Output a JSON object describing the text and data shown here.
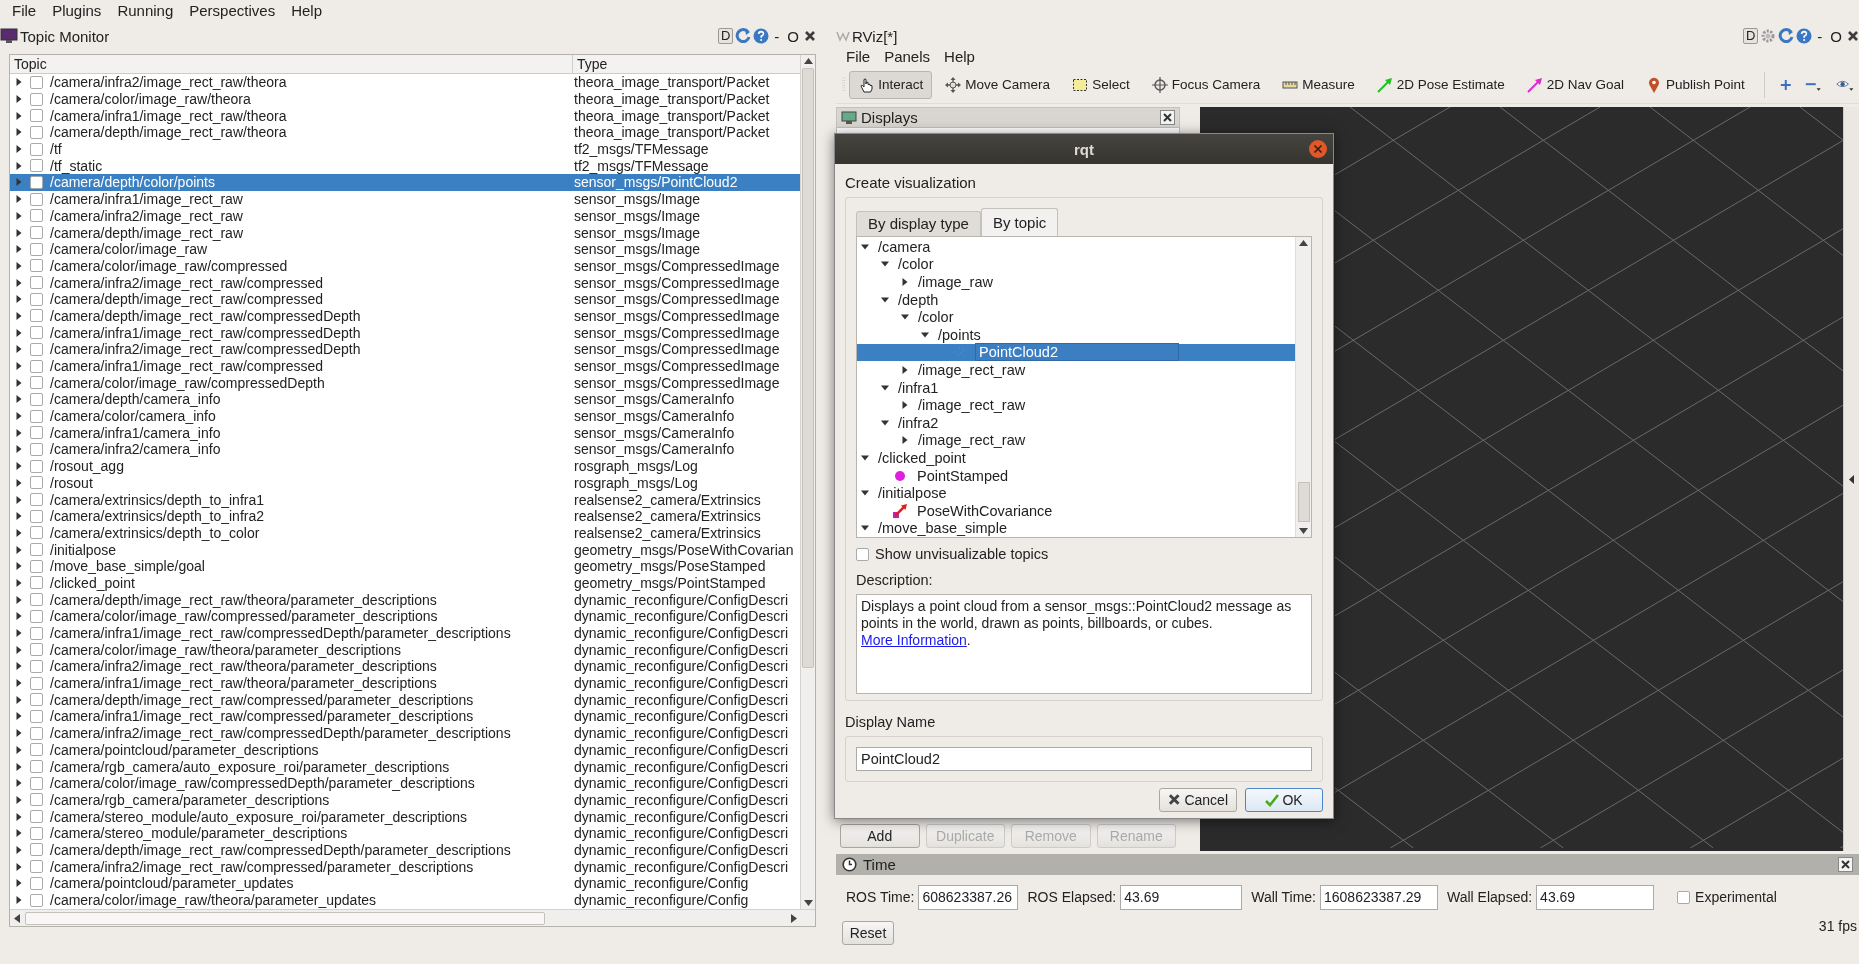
{
  "menu_bar": [
    "File",
    "Plugins",
    "Running",
    "Perspectives",
    "Help"
  ],
  "topic_monitor": {
    "title": "Topic Monitor",
    "dock_button": "D",
    "window_controls": [
      "-",
      "O"
    ],
    "columns": [
      "Topic",
      "Type"
    ],
    "rows": [
      {
        "topic": "/camera/infra2/image_rect_raw/theora",
        "type": "theora_image_transport/Packet",
        "expanded": false,
        "checked": false,
        "selected": false
      },
      {
        "topic": "/camera/color/image_raw/theora",
        "type": "theora_image_transport/Packet",
        "expanded": false,
        "checked": false,
        "selected": false
      },
      {
        "topic": "/camera/infra1/image_rect_raw/theora",
        "type": "theora_image_transport/Packet",
        "expanded": false,
        "checked": false,
        "selected": false
      },
      {
        "topic": "/camera/depth/image_rect_raw/theora",
        "type": "theora_image_transport/Packet",
        "expanded": false,
        "checked": false,
        "selected": false
      },
      {
        "topic": "/tf",
        "type": "tf2_msgs/TFMessage",
        "expanded": false,
        "checked": false,
        "selected": false
      },
      {
        "topic": "/tf_static",
        "type": "tf2_msgs/TFMessage",
        "expanded": false,
        "checked": false,
        "selected": false
      },
      {
        "topic": "/camera/depth/color/points",
        "type": "sensor_msgs/PointCloud2",
        "expanded": false,
        "checked": false,
        "selected": true
      },
      {
        "topic": "/camera/infra1/image_rect_raw",
        "type": "sensor_msgs/Image",
        "expanded": false,
        "checked": false,
        "selected": false
      },
      {
        "topic": "/camera/infra2/image_rect_raw",
        "type": "sensor_msgs/Image",
        "expanded": false,
        "checked": false,
        "selected": false
      },
      {
        "topic": "/camera/depth/image_rect_raw",
        "type": "sensor_msgs/Image",
        "expanded": false,
        "checked": false,
        "selected": false
      },
      {
        "topic": "/camera/color/image_raw",
        "type": "sensor_msgs/Image",
        "expanded": false,
        "checked": false,
        "selected": false
      },
      {
        "topic": "/camera/color/image_raw/compressed",
        "type": "sensor_msgs/CompressedImage",
        "expanded": false,
        "checked": false,
        "selected": false
      },
      {
        "topic": "/camera/infra2/image_rect_raw/compressed",
        "type": "sensor_msgs/CompressedImage",
        "expanded": false,
        "checked": false,
        "selected": false
      },
      {
        "topic": "/camera/depth/image_rect_raw/compressed",
        "type": "sensor_msgs/CompressedImage",
        "expanded": false,
        "checked": false,
        "selected": false
      },
      {
        "topic": "/camera/depth/image_rect_raw/compressedDepth",
        "type": "sensor_msgs/CompressedImage",
        "expanded": false,
        "checked": false,
        "selected": false
      },
      {
        "topic": "/camera/infra1/image_rect_raw/compressedDepth",
        "type": "sensor_msgs/CompressedImage",
        "expanded": false,
        "checked": false,
        "selected": false
      },
      {
        "topic": "/camera/infra2/image_rect_raw/compressedDepth",
        "type": "sensor_msgs/CompressedImage",
        "expanded": false,
        "checked": false,
        "selected": false
      },
      {
        "topic": "/camera/infra1/image_rect_raw/compressed",
        "type": "sensor_msgs/CompressedImage",
        "expanded": false,
        "checked": false,
        "selected": false
      },
      {
        "topic": "/camera/color/image_raw/compressedDepth",
        "type": "sensor_msgs/CompressedImage",
        "expanded": false,
        "checked": false,
        "selected": false
      },
      {
        "topic": "/camera/depth/camera_info",
        "type": "sensor_msgs/CameraInfo",
        "expanded": false,
        "checked": false,
        "selected": false
      },
      {
        "topic": "/camera/color/camera_info",
        "type": "sensor_msgs/CameraInfo",
        "expanded": false,
        "checked": false,
        "selected": false
      },
      {
        "topic": "/camera/infra1/camera_info",
        "type": "sensor_msgs/CameraInfo",
        "expanded": false,
        "checked": false,
        "selected": false
      },
      {
        "topic": "/camera/infra2/camera_info",
        "type": "sensor_msgs/CameraInfo",
        "expanded": false,
        "checked": false,
        "selected": false
      },
      {
        "topic": "/rosout_agg",
        "type": "rosgraph_msgs/Log",
        "expanded": false,
        "checked": false,
        "selected": false
      },
      {
        "topic": "/rosout",
        "type": "rosgraph_msgs/Log",
        "expanded": false,
        "checked": false,
        "selected": false
      },
      {
        "topic": "/camera/extrinsics/depth_to_infra1",
        "type": "realsense2_camera/Extrinsics",
        "expanded": false,
        "checked": false,
        "selected": false
      },
      {
        "topic": "/camera/extrinsics/depth_to_infra2",
        "type": "realsense2_camera/Extrinsics",
        "expanded": false,
        "checked": false,
        "selected": false
      },
      {
        "topic": "/camera/extrinsics/depth_to_color",
        "type": "realsense2_camera/Extrinsics",
        "expanded": false,
        "checked": false,
        "selected": false
      },
      {
        "topic": "/initialpose",
        "type": "geometry_msgs/PoseWithCovarian",
        "expanded": false,
        "checked": false,
        "selected": false
      },
      {
        "topic": "/move_base_simple/goal",
        "type": "geometry_msgs/PoseStamped",
        "expanded": false,
        "checked": false,
        "selected": false
      },
      {
        "topic": "/clicked_point",
        "type": "geometry_msgs/PointStamped",
        "expanded": false,
        "checked": false,
        "selected": false
      },
      {
        "topic": "/camera/depth/image_rect_raw/theora/parameter_descriptions",
        "type": "dynamic_reconfigure/ConfigDescri",
        "expanded": false,
        "checked": false,
        "selected": false
      },
      {
        "topic": "/camera/color/image_raw/compressed/parameter_descriptions",
        "type": "dynamic_reconfigure/ConfigDescri",
        "expanded": false,
        "checked": false,
        "selected": false
      },
      {
        "topic": "/camera/infra1/image_rect_raw/compressedDepth/parameter_descriptions",
        "type": "dynamic_reconfigure/ConfigDescri",
        "expanded": false,
        "checked": false,
        "selected": false
      },
      {
        "topic": "/camera/color/image_raw/theora/parameter_descriptions",
        "type": "dynamic_reconfigure/ConfigDescri",
        "expanded": false,
        "checked": false,
        "selected": false
      },
      {
        "topic": "/camera/infra2/image_rect_raw/theora/parameter_descriptions",
        "type": "dynamic_reconfigure/ConfigDescri",
        "expanded": false,
        "checked": false,
        "selected": false
      },
      {
        "topic": "/camera/infra1/image_rect_raw/theora/parameter_descriptions",
        "type": "dynamic_reconfigure/ConfigDescri",
        "expanded": false,
        "checked": false,
        "selected": false
      },
      {
        "topic": "/camera/depth/image_rect_raw/compressed/parameter_descriptions",
        "type": "dynamic_reconfigure/ConfigDescri",
        "expanded": false,
        "checked": false,
        "selected": false
      },
      {
        "topic": "/camera/infra1/image_rect_raw/compressed/parameter_descriptions",
        "type": "dynamic_reconfigure/ConfigDescri",
        "expanded": false,
        "checked": false,
        "selected": false
      },
      {
        "topic": "/camera/infra2/image_rect_raw/compressedDepth/parameter_descriptions",
        "type": "dynamic_reconfigure/ConfigDescri",
        "expanded": false,
        "checked": false,
        "selected": false
      },
      {
        "topic": "/camera/pointcloud/parameter_descriptions",
        "type": "dynamic_reconfigure/ConfigDescri",
        "expanded": false,
        "checked": false,
        "selected": false
      },
      {
        "topic": "/camera/rgb_camera/auto_exposure_roi/parameter_descriptions",
        "type": "dynamic_reconfigure/ConfigDescri",
        "expanded": false,
        "checked": false,
        "selected": false
      },
      {
        "topic": "/camera/color/image_raw/compressedDepth/parameter_descriptions",
        "type": "dynamic_reconfigure/ConfigDescri",
        "expanded": false,
        "checked": false,
        "selected": false
      },
      {
        "topic": "/camera/rgb_camera/parameter_descriptions",
        "type": "dynamic_reconfigure/ConfigDescri",
        "expanded": false,
        "checked": false,
        "selected": false
      },
      {
        "topic": "/camera/stereo_module/auto_exposure_roi/parameter_descriptions",
        "type": "dynamic_reconfigure/ConfigDescri",
        "expanded": false,
        "checked": false,
        "selected": false
      },
      {
        "topic": "/camera/stereo_module/parameter_descriptions",
        "type": "dynamic_reconfigure/ConfigDescri",
        "expanded": false,
        "checked": false,
        "selected": false
      },
      {
        "topic": "/camera/depth/image_rect_raw/compressedDepth/parameter_descriptions",
        "type": "dynamic_reconfigure/ConfigDescri",
        "expanded": false,
        "checked": false,
        "selected": false
      },
      {
        "topic": "/camera/infra2/image_rect_raw/compressed/parameter_descriptions",
        "type": "dynamic_reconfigure/ConfigDescri",
        "expanded": false,
        "checked": false,
        "selected": false
      },
      {
        "topic": "/camera/pointcloud/parameter_updates",
        "type": "dynamic_reconfigure/Config",
        "expanded": false,
        "checked": false,
        "selected": false
      },
      {
        "topic": "/camera/color/image_raw/theora/parameter_updates",
        "type": "dynamic_reconfigure/Config",
        "expanded": false,
        "checked": false,
        "selected": false
      }
    ]
  },
  "rviz": {
    "title": "RViz[*]",
    "dock_button": "D",
    "window_controls": [
      "-",
      "O"
    ],
    "menu": [
      "File",
      "Panels",
      "Help"
    ],
    "tools": [
      {
        "label": "Interact",
        "selected": true
      },
      {
        "label": "Move Camera",
        "selected": false
      },
      {
        "label": "Select",
        "selected": false
      },
      {
        "label": "Focus Camera",
        "selected": false
      },
      {
        "label": "Measure",
        "selected": false
      },
      {
        "label": "2D Pose Estimate",
        "selected": false
      },
      {
        "label": "2D Nav Goal",
        "selected": false
      },
      {
        "label": "Publish Point",
        "selected": false
      }
    ],
    "displays_panel": {
      "title": "Displays",
      "buttons": [
        {
          "label": "Add",
          "disabled": false
        },
        {
          "label": "Duplicate",
          "disabled": true
        },
        {
          "label": "Remove",
          "disabled": true
        },
        {
          "label": "Rename",
          "disabled": true
        }
      ]
    },
    "time_panel": {
      "title": "Time",
      "fields": [
        {
          "label": "ROS Time:",
          "value": "608623387.26"
        },
        {
          "label": "ROS Elapsed:",
          "value": "43.69"
        },
        {
          "label": "Wall Time:",
          "value": "1608623387.29"
        },
        {
          "label": "Wall Elapsed:",
          "value": "43.69"
        }
      ],
      "experimental": {
        "label": "Experimental",
        "checked": false
      },
      "reset_button": "Reset",
      "fps": "31 fps"
    }
  },
  "dialog": {
    "title": "rqt",
    "heading": "Create visualization",
    "tabs": [
      {
        "label": "By display type",
        "selected": false
      },
      {
        "label": "By topic",
        "selected": true
      }
    ],
    "tree": [
      {
        "label": "/camera",
        "kind": "topic",
        "expanded": true,
        "selected": false,
        "children": [
          {
            "label": "/color",
            "kind": "topic",
            "expanded": true,
            "selected": false,
            "children": [
              {
                "label": "/image_raw",
                "kind": "topic",
                "expanded": false,
                "selected": false
              }
            ]
          },
          {
            "label": "/depth",
            "kind": "topic",
            "expanded": true,
            "selected": false,
            "children": [
              {
                "label": "/color",
                "kind": "topic",
                "expanded": true,
                "selected": false,
                "children": [
                  {
                    "label": "/points",
                    "kind": "topic",
                    "expanded": true,
                    "selected": false,
                    "children": [
                      {
                        "label": "PointCloud2",
                        "kind": "cloud",
                        "selected": true
                      }
                    ]
                  }
                ]
              },
              {
                "label": "/image_rect_raw",
                "kind": "topic",
                "expanded": false,
                "selected": false
              }
            ]
          },
          {
            "label": "/infra1",
            "kind": "topic",
            "expanded": true,
            "selected": false,
            "children": [
              {
                "label": "/image_rect_raw",
                "kind": "topic",
                "expanded": false,
                "selected": false
              }
            ]
          },
          {
            "label": "/infra2",
            "kind": "topic",
            "expanded": true,
            "selected": false,
            "children": [
              {
                "label": "/image_rect_raw",
                "kind": "topic",
                "expanded": false,
                "selected": false
              }
            ]
          }
        ]
      },
      {
        "label": "/clicked_point",
        "kind": "topic",
        "expanded": true,
        "selected": false,
        "children": [
          {
            "label": "PointStamped",
            "kind": "point",
            "selected": false
          }
        ]
      },
      {
        "label": "/initialpose",
        "kind": "topic",
        "expanded": true,
        "selected": false,
        "children": [
          {
            "label": "PoseWithCovariance",
            "kind": "pose",
            "selected": false
          }
        ]
      },
      {
        "label": "/move_base_simple",
        "kind": "topic",
        "expanded": true,
        "selected": false
      }
    ],
    "show_unvisualizable": {
      "label": "Show unvisualizable topics",
      "checked": false
    },
    "description_label": "Description:",
    "description": {
      "text": "Displays a point cloud from a sensor_msgs::PointCloud2 message as points in the world, drawn as points, billboards, or cubes. ",
      "link": "More Information",
      "after": "."
    },
    "display_name_label": "Display Name",
    "display_name_value": "PointCloud2",
    "buttons": [
      {
        "label": "Cancel",
        "kind": "cancel"
      },
      {
        "label": "OK",
        "kind": "ok"
      }
    ]
  }
}
